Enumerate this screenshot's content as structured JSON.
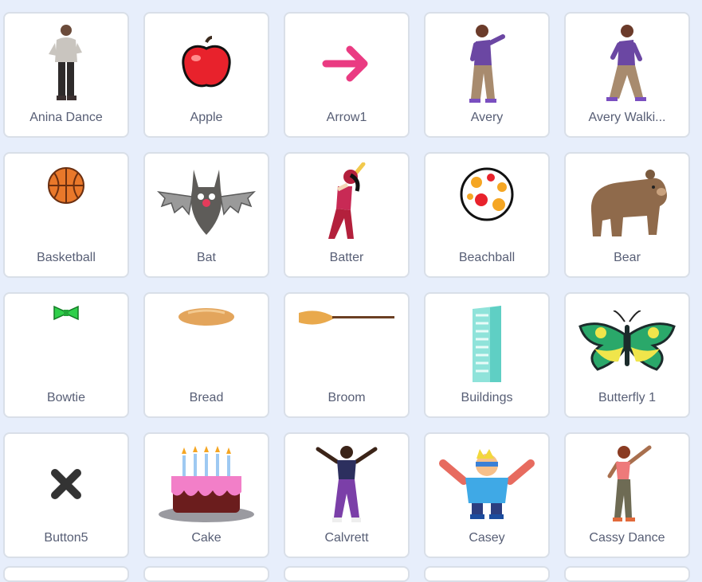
{
  "sprites": [
    {
      "name": "Anina Dance",
      "icon": "anina-dance-thumbnail"
    },
    {
      "name": "Apple",
      "icon": "apple-thumbnail"
    },
    {
      "name": "Arrow1",
      "icon": "arrow-thumbnail"
    },
    {
      "name": "Avery",
      "icon": "avery-thumbnail"
    },
    {
      "name": "Avery Walki...",
      "icon": "avery-walking-thumbnail"
    },
    {
      "name": "Basketball",
      "icon": "basketball-thumbnail"
    },
    {
      "name": "Bat",
      "icon": "bat-thumbnail"
    },
    {
      "name": "Batter",
      "icon": "batter-thumbnail"
    },
    {
      "name": "Beachball",
      "icon": "beachball-thumbnail"
    },
    {
      "name": "Bear",
      "icon": "bear-thumbnail"
    },
    {
      "name": "Bowtie",
      "icon": "bowtie-thumbnail"
    },
    {
      "name": "Bread",
      "icon": "bread-thumbnail"
    },
    {
      "name": "Broom",
      "icon": "broom-thumbnail"
    },
    {
      "name": "Buildings",
      "icon": "buildings-thumbnail"
    },
    {
      "name": "Butterfly 1",
      "icon": "butterfly-thumbnail"
    },
    {
      "name": "Button5",
      "icon": "button-x-thumbnail"
    },
    {
      "name": "Cake",
      "icon": "cake-thumbnail"
    },
    {
      "name": "Calvrett",
      "icon": "calvrett-thumbnail"
    },
    {
      "name": "Casey",
      "icon": "casey-thumbnail"
    },
    {
      "name": "Cassy Dance",
      "icon": "cassy-dance-thumbnail"
    }
  ],
  "colors": {
    "background": "#e7eefb",
    "tile_border": "#d9dfe8",
    "label_text": "#575e75"
  }
}
